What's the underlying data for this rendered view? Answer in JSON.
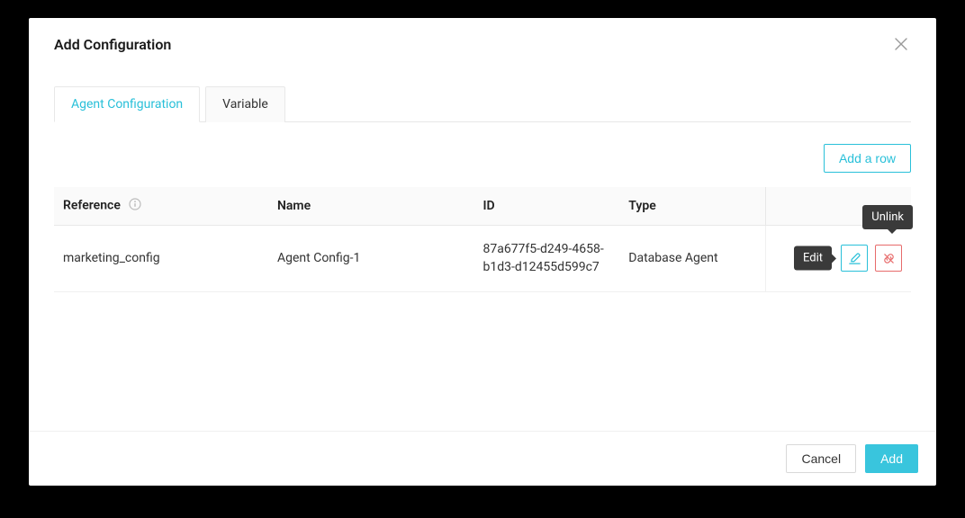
{
  "modal": {
    "title": "Add Configuration"
  },
  "tabs": {
    "agent_config": "Agent Configuration",
    "variable": "Variable"
  },
  "toolbar": {
    "add_row": "Add a row"
  },
  "table": {
    "headers": {
      "reference": "Reference",
      "name": "Name",
      "id": "ID",
      "type": "Type"
    },
    "rows": [
      {
        "reference": "marketing_config",
        "name": "Agent Config-1",
        "id": "87a677f5-d249-4658-b1d3-d12455d599c7",
        "type": "Database Agent"
      }
    ]
  },
  "tooltips": {
    "edit": "Edit",
    "unlink": "Unlink"
  },
  "footer": {
    "cancel": "Cancel",
    "add": "Add"
  }
}
